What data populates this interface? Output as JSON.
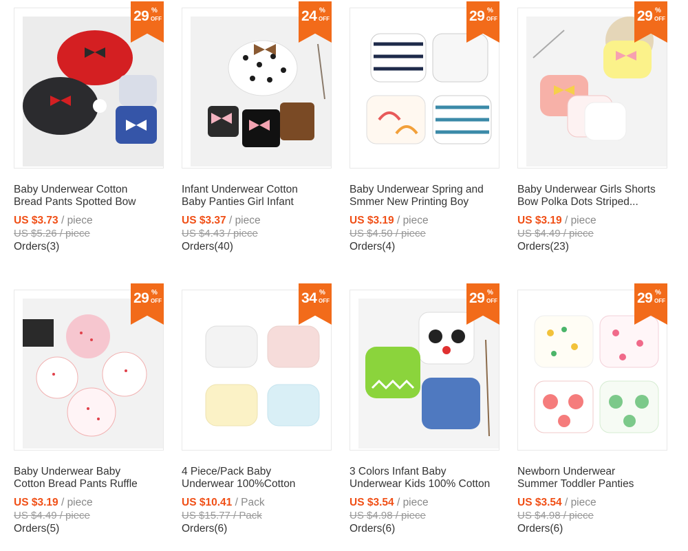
{
  "products": [
    {
      "discount": "29",
      "title_line1": "Baby Underwear Cotton",
      "title_line2": "Bread Pants Spotted Bow",
      "price": "US $3.73",
      "unit": "/ piece",
      "old_price": "US $5.26 / piece",
      "orders": "Orders(3)"
    },
    {
      "discount": "24",
      "title_line1": "Infant Underwear Cotton",
      "title_line2": "Baby Panties Girl Infant",
      "price": "US $3.37",
      "unit": "/ piece",
      "old_price": "US $4.43 / piece",
      "orders": "Orders(40)"
    },
    {
      "discount": "29",
      "title_line1": "Baby Underwear Spring and",
      "title_line2": "Smmer New Printing Boy",
      "price": "US $3.19",
      "unit": "/ piece",
      "old_price": "US $4.50 / piece",
      "orders": "Orders(4)"
    },
    {
      "discount": "29",
      "title_line1": "Baby Underwear Girls Shorts",
      "title_line2": "Bow Polka Dots Striped...",
      "price": "US $3.19",
      "unit": "/ piece",
      "old_price": "US $4.49 / piece",
      "orders": "Orders(23)"
    },
    {
      "discount": "29",
      "title_line1": "Baby Underwear Baby",
      "title_line2": "Cotton Bread Pants Ruffle",
      "price": "US $3.19",
      "unit": "/ piece",
      "old_price": "US $4.49 / piece",
      "orders": "Orders(5)"
    },
    {
      "discount": "34",
      "title_line1": "4 Piece/Pack Baby",
      "title_line2": "Underwear 100%Cotton",
      "price": "US $10.41",
      "unit": "/ Pack",
      "old_price": "US $15.77 / Pack",
      "orders": "Orders(6)"
    },
    {
      "discount": "29",
      "title_line1": "3 Colors Infant Baby",
      "title_line2": "Underwear Kids 100% Cotton",
      "price": "US $3.54",
      "unit": "/ piece",
      "old_price": "US $4.98 / piece",
      "orders": "Orders(6)"
    },
    {
      "discount": "29",
      "title_line1": "Newborn Underwear",
      "title_line2": "Summer Toddler Panties",
      "price": "US $3.54",
      "unit": "/ piece",
      "old_price": "US $4.98 / piece",
      "orders": "Orders(6)"
    }
  ],
  "badge": {
    "percent_symbol": "%",
    "off_label": "OFF"
  },
  "colors": {
    "accent": "#f26b1a",
    "price": "#f04f16",
    "border": "#e8e8e8"
  }
}
